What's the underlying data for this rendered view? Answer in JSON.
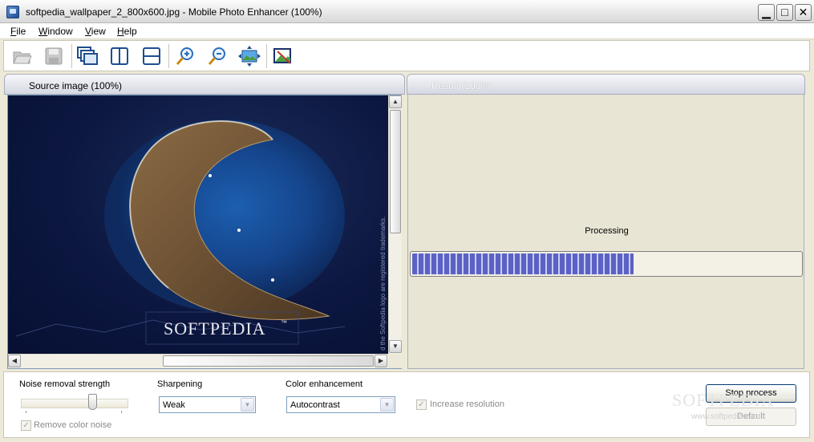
{
  "window": {
    "title": "softpedia_wallpaper_2_800x600.jpg - Mobile Photo Enhancer (100%)",
    "min_glyph": "▁",
    "max_glyph": "□",
    "close_glyph": "✕"
  },
  "menu": {
    "file": {
      "ul": "F",
      "rest": "ile"
    },
    "window": {
      "ul": "W",
      "rest": "indow"
    },
    "view": {
      "ul": "V",
      "rest": "iew"
    },
    "help": {
      "ul": "H",
      "rest": "elp"
    }
  },
  "toolbar": {
    "icons": [
      "open-folder-icon",
      "save-icon",
      "cascade-windows-icon",
      "split-vertical-icon",
      "split-horizontal-icon",
      "zoom-in-icon",
      "zoom-out-icon",
      "fit-to-window-icon",
      "enhance-image-icon"
    ]
  },
  "source_panel": {
    "title": "Source image (100%)",
    "watermark_text": "SOFTPEDIA",
    "trademark": "™",
    "side_text": "d the Softpedia logo are registered trademarks."
  },
  "result_panel": {
    "title": "Result (100%)",
    "status": "Processing",
    "progress_percent": 57
  },
  "scrollbar": {
    "up": "▲",
    "down": "▼",
    "left": "◀",
    "right": "▶"
  },
  "controls": {
    "noise_label": "Noise removal strength",
    "noise_value_fraction": 0.68,
    "remove_color_noise": "Remove color noise",
    "sharpening_label": "Sharpening",
    "sharpening_value": "Weak",
    "color_label": "Color enhancement",
    "color_value": "Autocontrast",
    "increase_resolution": "Increase resolution",
    "check_glyph": "✓",
    "dropdown_glyph": "▼",
    "stop_button": "Stop process",
    "default_button": "Default"
  },
  "brand_watermark": {
    "main": "SOFTPEDIA",
    "sub": "www.softpedia.com"
  }
}
